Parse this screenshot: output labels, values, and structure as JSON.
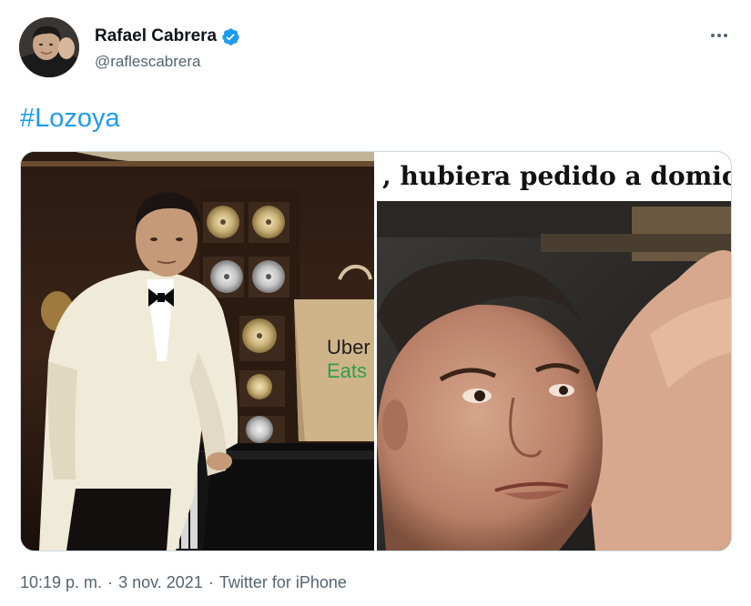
{
  "author": {
    "display_name": "Rafael Cabrera",
    "handle": "@raflescabrera",
    "verified": true
  },
  "tweet": {
    "text": "#Lozoya",
    "hashtag_color": "#1d9bf0"
  },
  "media": {
    "left_image": {
      "bag_brand_line1": "Uber",
      "bag_brand_line2": "Eats"
    },
    "right_image": {
      "caption": ", hubiera pedido a domic"
    }
  },
  "footer": {
    "time": "10:19 p. m.",
    "sep1": "·",
    "date": "3 nov. 2021",
    "sep2": "·",
    "source": "Twitter for iPhone"
  },
  "icons": {
    "verified": "verified-badge-icon",
    "more": "more-options-icon"
  }
}
